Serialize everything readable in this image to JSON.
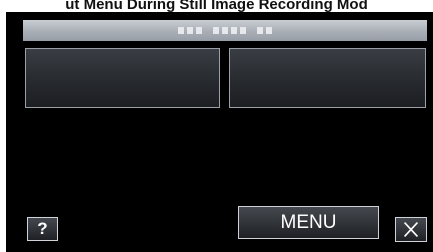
{
  "caption": "ut Menu During Still Image Recording Mod",
  "buttons": {
    "help_label": "?",
    "menu_label": "MENU"
  },
  "icons": {
    "close": "close-icon"
  },
  "colors": {
    "screen_background": "#000000",
    "title_bar": "#a9aeb6",
    "tile_border": "#9aa0a8",
    "button_border": "#cfd3d8",
    "text": "#ffffff"
  }
}
